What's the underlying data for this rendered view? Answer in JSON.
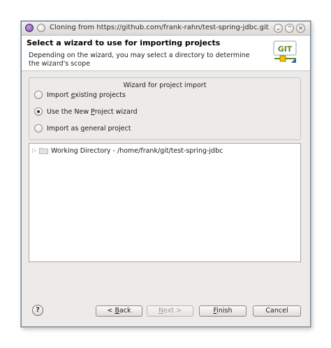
{
  "window": {
    "title": "Cloning from https://github.com/frank-rahn/test-spring-jdbc.git",
    "minimize_glyph": "⌄",
    "maximize_glyph": "⌃",
    "close_glyph": "✕"
  },
  "header": {
    "title": "Select a wizard to use for importing projects",
    "description": "Depending on the wizard, you may select a directory to determine the wizard's scope",
    "logo_text": "GIT"
  },
  "wizard_group": {
    "legend": "Wizard for project import",
    "options": [
      {
        "pre": "Import ",
        "mnemonic": "e",
        "post": "xisting projects",
        "checked": false
      },
      {
        "pre": "Use the New ",
        "mnemonic": "P",
        "post": "roject wizard",
        "checked": true
      },
      {
        "pre": "Import as ",
        "mnemonic": "g",
        "post": "eneral project",
        "checked": false
      }
    ]
  },
  "tree": {
    "items": [
      {
        "label": "Working Directory - /home/frank/git/test-spring-jdbc"
      }
    ]
  },
  "buttons": {
    "help": "?",
    "back": {
      "pre": "< ",
      "mnemonic": "B",
      "post": "ack"
    },
    "next": {
      "pre": "",
      "mnemonic": "N",
      "post": "ext >"
    },
    "finish": {
      "pre": "",
      "mnemonic": "F",
      "post": "inish"
    },
    "cancel": "Cancel"
  },
  "colors": {
    "window_bg": "#edebe9",
    "header_bg": "#ffffff",
    "logo_green": "#5a8a2e",
    "folder": "#c8c6c2"
  }
}
